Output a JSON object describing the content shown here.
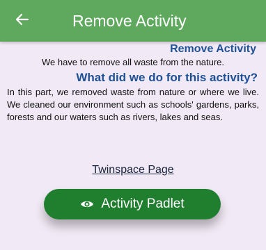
{
  "app_bar": {
    "title": "Remove Activity",
    "back_icon": "arrow-left-icon"
  },
  "section": {
    "heading": "Remove Activity",
    "subtitle": "We have to remove all waste from the nature.",
    "question": "What did we do for this activity?",
    "paragraph": "In this part, we removed waste from nature or where we live. We cleaned our environment such as schools' gardens, parks, forests and our waters such as rivers, lakes and seas."
  },
  "links": {
    "twinspace_label": "Twinspace Page"
  },
  "padlet_button": {
    "label": "Activity Padlet",
    "icon": "eye-icon"
  },
  "colors": {
    "app_bar": "#5fa95f",
    "background": "#f1e9f5",
    "heading": "#1f5196",
    "button": "#207e2f"
  }
}
